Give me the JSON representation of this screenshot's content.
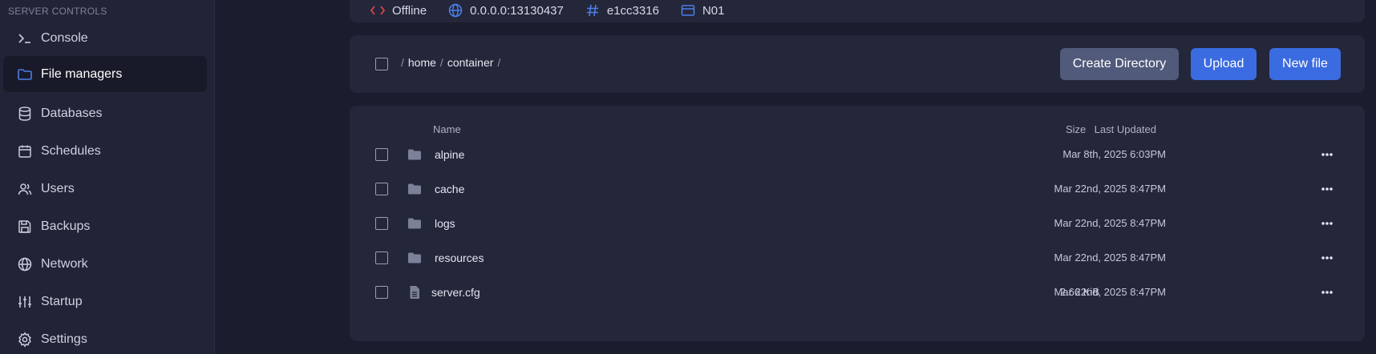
{
  "sidebar": {
    "heading": "SERVER CONTROLS",
    "items": [
      {
        "label": "Console",
        "icon": "terminal-icon"
      },
      {
        "label": "File managers",
        "icon": "folder-icon",
        "active": true
      },
      {
        "label": "Databases",
        "icon": "database-icon"
      },
      {
        "label": "Schedules",
        "icon": "calendar-icon"
      },
      {
        "label": "Users",
        "icon": "users-icon"
      },
      {
        "label": "Backups",
        "icon": "floppy-disk-icon"
      },
      {
        "label": "Network",
        "icon": "globe-icon"
      },
      {
        "label": "Startup",
        "icon": "sliders-icon"
      },
      {
        "label": "Settings",
        "icon": "gear-icon"
      }
    ]
  },
  "status_bar": {
    "status": "Offline",
    "address": "0.0.0.0:13130437",
    "id": "e1cc3316",
    "node": "N01"
  },
  "breadcrumb": {
    "separator": "/",
    "parts": [
      "home",
      "container"
    ]
  },
  "actions": {
    "create_directory": "Create Directory",
    "upload": "Upload",
    "new_file": "New file"
  },
  "file_list": {
    "headers": {
      "name": "Name",
      "size": "Size",
      "updated": "Last Updated"
    },
    "rows": [
      {
        "type": "folder",
        "name": "alpine",
        "size": "",
        "updated": "Mar 8th, 2025 6:03PM"
      },
      {
        "type": "folder",
        "name": "cache",
        "size": "",
        "updated": "Mar 22nd, 2025 8:47PM"
      },
      {
        "type": "folder",
        "name": "logs",
        "size": "",
        "updated": "Mar 22nd, 2025 8:47PM"
      },
      {
        "type": "folder",
        "name": "resources",
        "size": "",
        "updated": "Mar 22nd, 2025 8:47PM"
      },
      {
        "type": "file",
        "name": "server.cfg",
        "size": "2.66 KiB",
        "updated": "Mar 22nd, 2025 8:47PM"
      }
    ]
  },
  "colors": {
    "accent": "#3b6be0",
    "active_icon": "#4c7fe8",
    "offline": "#e0434b"
  }
}
